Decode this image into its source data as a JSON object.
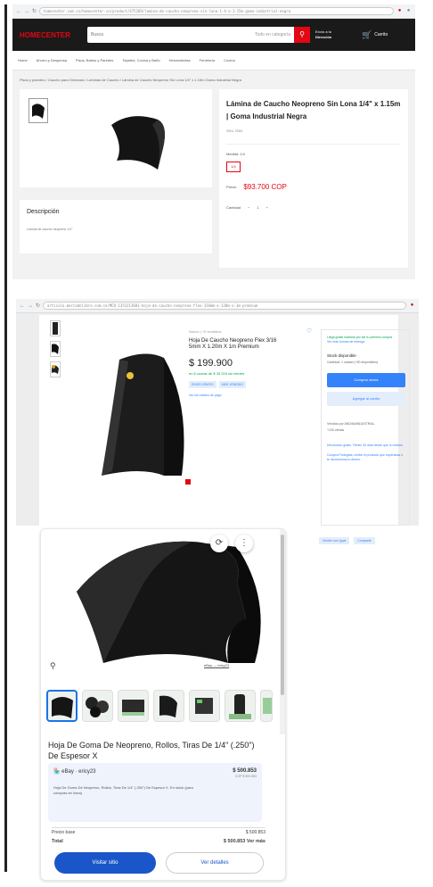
{
  "panel1": {
    "url": "homecenter.com.co/homecenter-co/product/475269/lamina-de-caucho-neopreno-sin-lona-1-4-x-1-15m-goma-industrial-negra",
    "logo": "HOMECENTER",
    "search_placeholder": "Busca",
    "search_category": "Todo en categoría",
    "location_line1": "Envío a tu",
    "location_line2": "Dirección",
    "cart_label": "Carrito",
    "menu": [
      "Home",
      "Ahorro y Despensa",
      "Pisos, Baños y Paredes",
      "Tapetes, Cocina y Baño",
      "Herramientas",
      "Ferretería",
      "Cocina"
    ],
    "breadcrumb": "Pisos y paredes / Caucho para Gimnasio / Láminas de Caucho / Lámina de Caucho Neopreno Sin Lona 1/4\" x 1.15m Goma Industrial Negra",
    "title": "Lámina de Caucho Neopreno Sin Lona 1/4\" x 1.15m | Goma Industrial Negra",
    "sku": "SKU 7654",
    "size_label": "Medida: 1/4",
    "size_option": "1/4",
    "price_label": "Precio",
    "price": "$93.700 COP",
    "qty_label": "Cantidad",
    "qty_value": "1",
    "description_heading": "Descripción",
    "description_text": "Lámina de caucho neopreno 1/4\""
  },
  "panel2": {
    "url": "articulo.mercadolibre.com.co/MCO-1351213601-hoja-de-caucho-neopreno-flex-316mm-x-120m-x-1m-premium",
    "condition": "Nuevo | +5 vendidos",
    "title": "Hoja De Caucho Neopreno Flex 3/16 5mm X 1.20m X 1m Premium",
    "price": "$ 199.900",
    "installments": "en 6 cuotas de $ 33.316 sin interés",
    "tags": [
      "ENVÍO GRATIS",
      "MÁS VENDIDO"
    ],
    "payment_link": "Ver los medios de pago",
    "shipping": "Llega gratis mañana por ser tu primera compra",
    "shipping_link": "Ver más formas de entrega",
    "stock": "Stock disponible",
    "quantity": "Cantidad: 1 unidad (+50 disponibles)",
    "buy_now": "Comprar ahora",
    "add_cart": "Agregar al carrito",
    "seller": "Vendido por ANDINAINDUSTRIAL",
    "seller_sales": "+100 ventas",
    "protection": "Devolución gratis. Tienes 30 días desde que lo recibes.",
    "protection2": "Compra Protegida, recibe el producto que esperabas o te devolvemos tu dinero.",
    "strip": [
      "Vender uno igual",
      "Compartir"
    ]
  },
  "panel3": {
    "image_source": "eBay — ericy23",
    "title": "Hoja De Goma De Neopreno, Rollos, Tiras De 1/4\" (.250\") De Espesor X",
    "seller": "eBay · ericy23",
    "price": "$ 500.853",
    "price_sub": "COP $ 500.853",
    "desc": "Hoja De Goma De Neopreno, Rollos, Tiras De 1/4\" (.250\") De Espesor X. En stock (para compras en línea)",
    "rows": [
      {
        "label": "Precio base",
        "value": "$ 500.853"
      },
      {
        "label": "Total",
        "value": "$ 500.853 Ver más"
      }
    ],
    "visit_button": "Visitar sitio",
    "details_button": "Ver detalles",
    "thumbs": 7
  },
  "colors": {
    "homecenter_red": "#e30613",
    "ml_blue": "#3483fa",
    "google_blue": "#1a56c9"
  }
}
